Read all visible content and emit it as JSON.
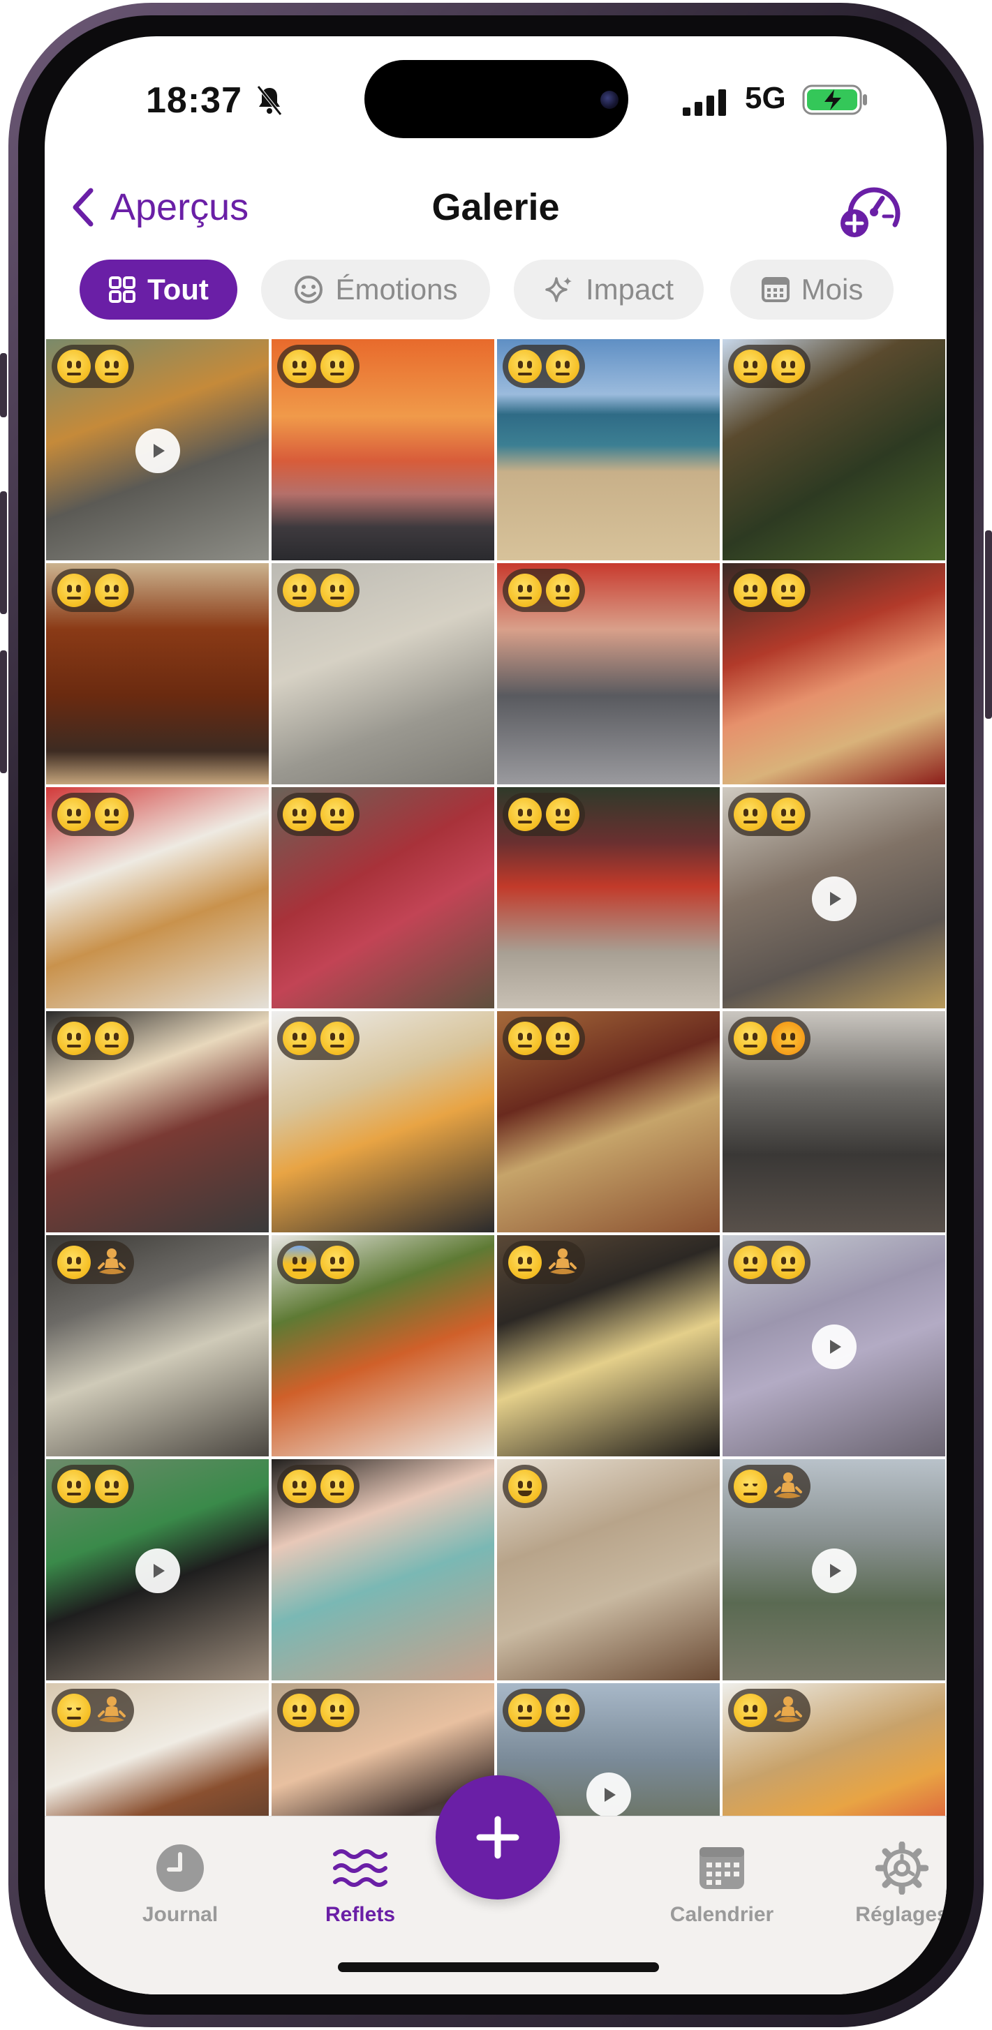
{
  "status": {
    "time": "18:37",
    "network": "5G",
    "icons": [
      "bell-slash-icon",
      "signal-icon",
      "battery-charging-icon"
    ]
  },
  "nav": {
    "back_label": "Aperçus",
    "title": "Galerie",
    "action_icon": "gauge-plus-icon"
  },
  "filters": [
    {
      "label": "Tout",
      "icon": "grid-icon",
      "active": true
    },
    {
      "label": "Émotions",
      "icon": "smiley-icon",
      "active": false
    },
    {
      "label": "Impact",
      "icon": "sparkle-icon",
      "active": false
    },
    {
      "label": "Mois",
      "icon": "calendar-icon",
      "active": false
    }
  ],
  "gallery": [
    {
      "bg": "linear-gradient(160deg,#7a8a6a 0%,#c58a3a 35%,#5b5a55 60%,#8d8d86 100%)",
      "emotions": [
        "neutral",
        "neutral"
      ],
      "video": true
    },
    {
      "bg": "linear-gradient(180deg,#e86a2c 0%,#f09a4a 35%,#d85c3a 55%,#b5706a 70%,#3e3a3e 85%,#2a2a2e 100%)",
      "emotions": [
        "neutral",
        "neutral"
      ],
      "video": false
    },
    {
      "bg": "linear-gradient(180deg,#5f8fc4 0%,#9bbbdd 25%,#2f6b86 34%,#3c7f93 48%,#c8b089 60%,#d7c29a 100%)",
      "emotions": [
        "neutral",
        "neutral"
      ],
      "video": false
    },
    {
      "bg": "linear-gradient(150deg,#c7d7ea 0%,#5a4a2e 30%,#2d3a22 60%,#4f6b2c 100%)",
      "emotions": [
        "neutral",
        "neutral"
      ],
      "video": false
    },
    {
      "bg": "linear-gradient(180deg,#cbb38f 0%,#8a3a16 30%,#6a2a10 60%,#3d2b22 85%,#c5a57c 100%)",
      "emotions": [
        "neutral",
        "neutral"
      ],
      "video": false
    },
    {
      "bg": "linear-gradient(160deg,#bcbab3 0%,#d6d1c4 40%,#9a9890 70%,#7c7a74 100%)",
      "emotions": [
        "neutral",
        "neutral"
      ],
      "video": false
    },
    {
      "bg": "linear-gradient(180deg,#c83a2e 0%,#d9a08a 30%,#595a5f 60%,#9a9a9e 100%)",
      "emotions": [
        "neutral",
        "neutral"
      ],
      "video": false
    },
    {
      "bg": "linear-gradient(160deg,#3a2a26 0%,#b23a2a 35%,#e6916c 55%,#d9b27a 75%,#8c1e1a 100%)",
      "emotions": [
        "neutral",
        "neutral"
      ],
      "video": false
    },
    {
      "bg": "linear-gradient(160deg,#d23a3a 0%,#eeeae2 35%,#c9924c 60%,#e4e0d8 100%)",
      "emotions": [
        "neutral",
        "neutral"
      ],
      "video": false
    },
    {
      "bg": "linear-gradient(150deg,#6a6358 0%,#a8323a 40%,#c24455 60%,#5e503e 100%)",
      "emotions": [
        "neutral",
        "neutral"
      ],
      "video": false
    },
    {
      "bg": "linear-gradient(180deg,#2f3a2a 0%,#6a3030 25%,#c23a2a 45%,#a8a094 75%,#c8c0b4 100%)",
      "emotions": [
        "neutral",
        "neutral"
      ],
      "video": false
    },
    {
      "bg": "linear-gradient(160deg,#cfcac0 0%,#807266 40%,#5c5550 70%,#b89a5a 100%)",
      "emotions": [
        "neutral",
        "neutral"
      ],
      "video": true
    },
    {
      "bg": "linear-gradient(160deg,#2a2a2a 0%,#e8d8bc 30%,#7a3a34 55%,#3a3a3a 100%)",
      "emotions": [
        "neutral",
        "neutral"
      ],
      "video": false
    },
    {
      "bg": "linear-gradient(160deg,#eeeeee 0%,#d8c49a 35%,#e8a444 55%,#2a2a2c 100%)",
      "emotions": [
        "neutral",
        "neutral"
      ],
      "video": false
    },
    {
      "bg": "linear-gradient(160deg,#a56a3a 0%,#6a2a1e 35%,#c6a46a 55%,#8a5030 100%)",
      "emotions": [
        "neutral",
        "neutral"
      ],
      "video": false
    },
    {
      "bg": "linear-gradient(180deg,#cac6c0 0%,#6c6a66 35%,#3a3836 65%,#58504a 100%)",
      "emotions": [
        "neutral",
        "sun"
      ],
      "video": false
    },
    {
      "bg": "linear-gradient(160deg,#3a3834 0%,#6c6a66 30%,#cfcab8 55%,#4a4640 100%)",
      "emotions": [
        "neutral",
        "yoga"
      ],
      "video": false
    },
    {
      "bg": "linear-gradient(160deg,#e8e6e2 0%,#5e7a34 30%,#d0602a 55%,#eeeeea 100%)",
      "emotions": [
        "fear",
        "neutral"
      ],
      "video": false
    },
    {
      "bg": "linear-gradient(160deg,#5a4836 0%,#2c2824 30%,#e4cf8a 55%,#1a1816 100%)",
      "emotions": [
        "neutral",
        "yoga"
      ],
      "video": false
    },
    {
      "bg": "linear-gradient(160deg,#c8cdd4 0%,#9c96ae 35%,#b3abc4 55%,#6a6470 100%)",
      "emotions": [
        "neutral",
        "neutral"
      ],
      "video": true
    },
    {
      "bg": "linear-gradient(160deg,#6c8a6a 0%,#3a8a4a 35%,#1e1e1e 55%,#9a8a7a 100%)",
      "emotions": [
        "neutral",
        "neutral"
      ],
      "video": true
    },
    {
      "bg": "linear-gradient(160deg,#22201e 0%,#e8c8b8 30%,#7ab8b4 55%,#c9a08a 100%)",
      "emotions": [
        "neutral",
        "neutral"
      ],
      "video": false
    },
    {
      "bg": "linear-gradient(160deg,#e8e0d4 0%,#b8a48a 35%,#c8b8a0 60%,#6a4a34 100%)",
      "emotions": [
        "happy",
        "none"
      ],
      "video": false
    },
    {
      "bg": "linear-gradient(180deg,#b9c2ca 0%,#8a9292 35%,#5a6a52 65%,#7a7a6a 100%)",
      "emotions": [
        "relieved",
        "yoga"
      ],
      "video": true
    },
    {
      "bg": "linear-gradient(160deg,#d8c8b0 0%,#f0ece4 35%,#8a5030 55%,#2a2a2a 100%)",
      "emotions": [
        "relieved",
        "yoga"
      ],
      "video": false
    },
    {
      "bg": "linear-gradient(160deg,#b8a48a 0%,#e8c0a0 35%,#4a3a34 60%,#9ab8c8 100%)",
      "emotions": [
        "neutral",
        "neutral"
      ],
      "video": false
    },
    {
      "bg": "linear-gradient(180deg,#a8b8c8 0%,#7a8a98 35%,#6a7260 65%,#8a8a7a 100%)",
      "emotions": [
        "neutral",
        "neutral"
      ],
      "video": true
    },
    {
      "bg": "linear-gradient(160deg,#eeeeea 0%,#c8a26a 35%,#e8a444 55%,#d84a3a 80%,#f0f0ec 100%)",
      "emotions": [
        "neutral",
        "yoga"
      ],
      "video": false
    }
  ],
  "tabs": [
    {
      "label": "Journal",
      "icon": "clock-icon",
      "active": false
    },
    {
      "label": "Reflets",
      "icon": "waves-icon",
      "active": true
    },
    {
      "label": "Calendrier",
      "icon": "calendar-grid-icon",
      "active": false
    },
    {
      "label": "Réglages",
      "icon": "gear-icon",
      "active": false
    }
  ],
  "fab_icon": "plus-icon",
  "colors": {
    "accent": "#6a1fa6",
    "chip_bg": "#efefef",
    "tabbar_bg": "#f3f1ef"
  }
}
